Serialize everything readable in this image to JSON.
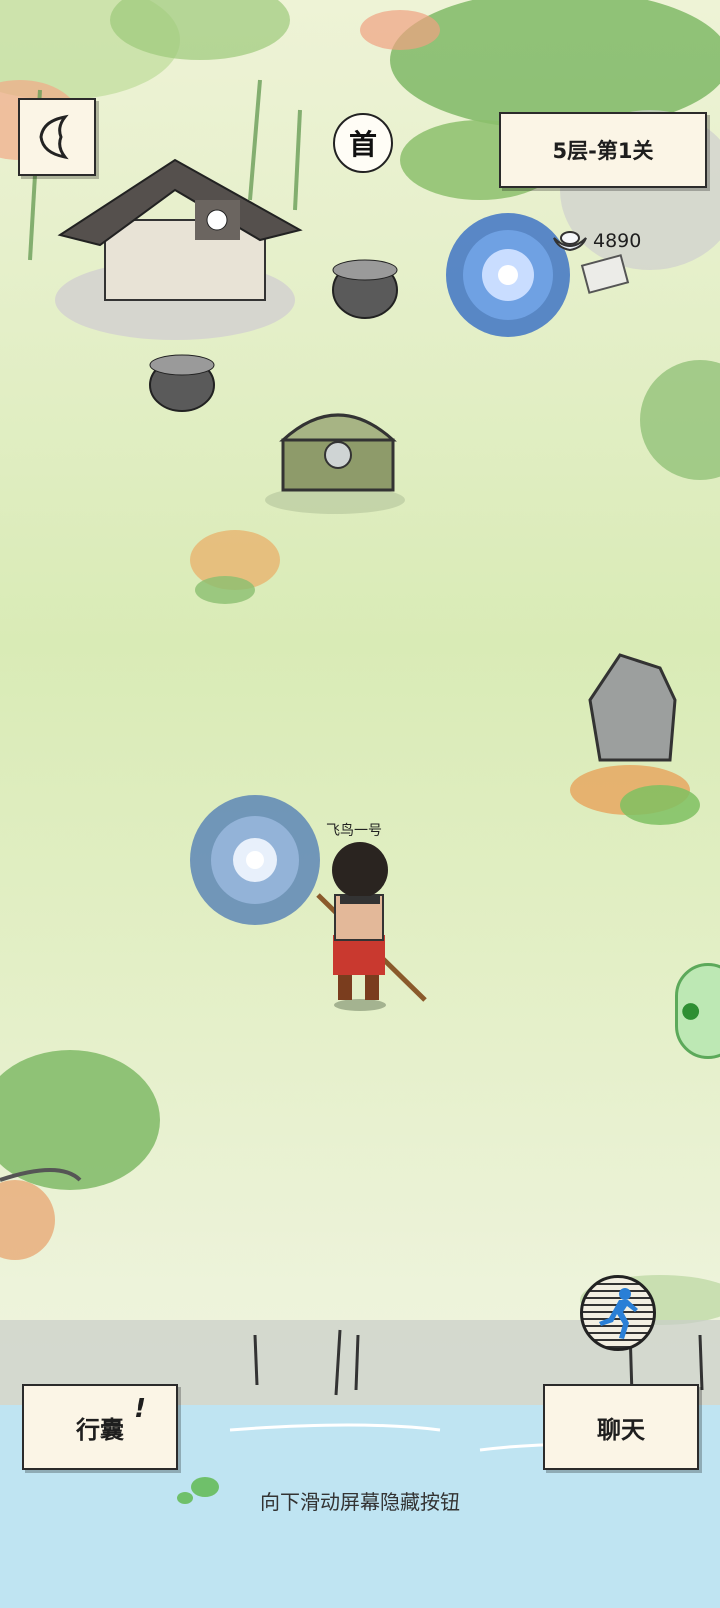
{
  "header": {
    "back_icon": "back-arrow-icon",
    "level_label": "5层-第1关",
    "first_badge": "首"
  },
  "resources": {
    "coin_icon": "ingot-icon",
    "coin_value": "4890"
  },
  "player": {
    "name": "飞鸟一号"
  },
  "buttons": {
    "bag_label": "行囊",
    "bag_alert": "!",
    "chat_label": "聊天",
    "run_icon": "running-man-icon"
  },
  "footer": {
    "hint": "向下滑动屏幕隐藏按钮"
  },
  "colors": {
    "button_bg": "#fbf5e6",
    "ink": "#2b2b2b",
    "grass": "#d9ebb6",
    "water": "#bfe4f2",
    "side_tab": "#5ca95a"
  }
}
